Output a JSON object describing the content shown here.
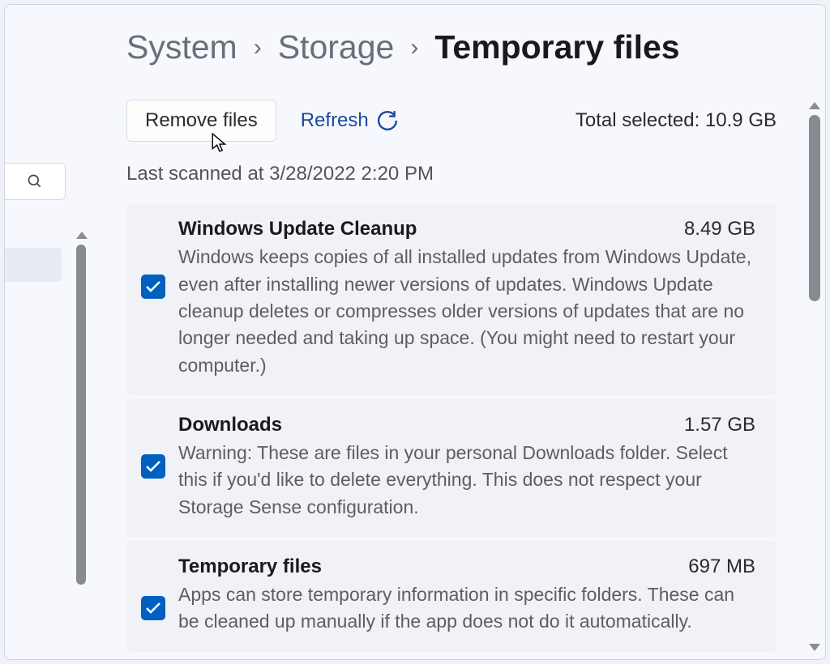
{
  "breadcrumb": {
    "system": "System",
    "storage": "Storage",
    "current": "Temporary files"
  },
  "actions": {
    "remove": "Remove files",
    "refresh": "Refresh"
  },
  "summary": {
    "total_label": "Total selected: ",
    "total_value": "10.9 GB",
    "last_scanned": "Last scanned at 3/28/2022 2:20 PM"
  },
  "items": [
    {
      "title": "Windows Update Cleanup",
      "size": "8.49 GB",
      "description": "Windows keeps copies of all installed updates from Windows Update, even after installing newer versions of updates. Windows Update cleanup deletes or compresses older versions of updates that are no longer needed and taking up space. (You might need to restart your computer.)",
      "checked": true
    },
    {
      "title": "Downloads",
      "size": "1.57 GB",
      "description": "Warning: These are files in your personal Downloads folder. Select this if you'd like to delete everything. This does not respect your Storage Sense configuration.",
      "checked": true
    },
    {
      "title": "Temporary files",
      "size": "697 MB",
      "description": "Apps can store temporary information in specific folders. These can be cleaned up manually if the app does not do it automatically.",
      "checked": true
    }
  ]
}
